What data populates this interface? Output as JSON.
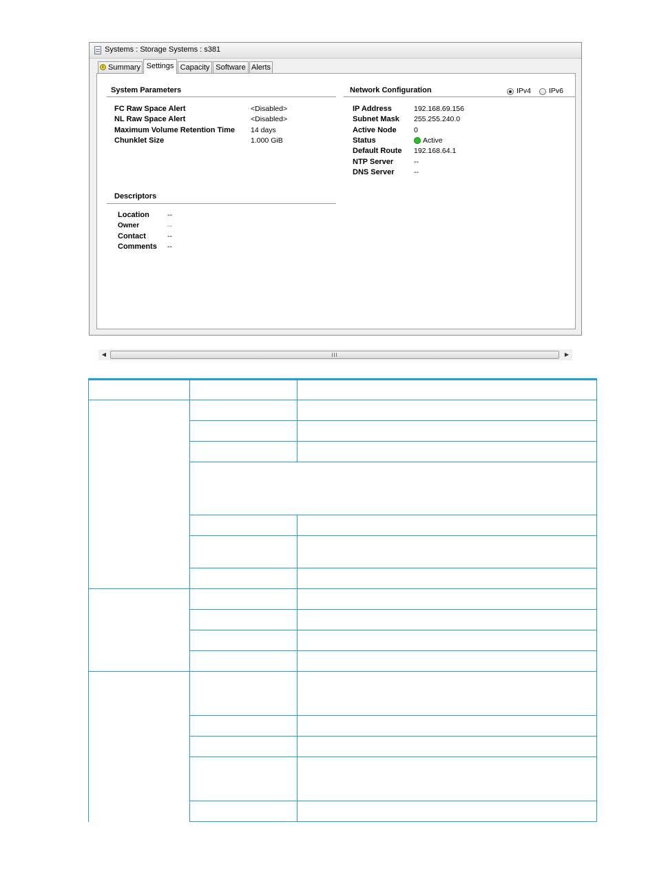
{
  "window": {
    "title": "Systems : Storage Systems : s381",
    "icon": "storage-system-icon"
  },
  "tabs": [
    {
      "label": "Summary",
      "icon": "summary-status-icon"
    },
    {
      "label": "Settings",
      "active": true
    },
    {
      "label": "Capacity"
    },
    {
      "label": "Software"
    },
    {
      "label": "Alerts"
    }
  ],
  "system_parameters": {
    "title": "System Parameters",
    "rows": [
      {
        "label": "FC Raw Space Alert",
        "value": "<Disabled>"
      },
      {
        "label": "NL Raw Space Alert",
        "value": "<Disabled>"
      },
      {
        "label": "Maximum Volume Retention Time",
        "value": "14 days"
      },
      {
        "label": "Chunklet Size",
        "value": "1.000 GiB"
      }
    ]
  },
  "descriptors": {
    "title": "Descriptors",
    "rows": [
      {
        "label": "Location",
        "value": "--"
      },
      {
        "label": "Owner",
        "value": "--"
      },
      {
        "label": "Contact",
        "value": "--"
      },
      {
        "label": "Comments",
        "value": "--"
      }
    ]
  },
  "network_configuration": {
    "title": "Network Configuration",
    "ip_versions": [
      {
        "label": "IPv4",
        "selected": true
      },
      {
        "label": "IPv6",
        "selected": false
      }
    ],
    "rows": [
      {
        "label": "IP Address",
        "value": "192.168.69.156"
      },
      {
        "label": "Subnet Mask",
        "value": "255.255.240.0"
      },
      {
        "label": "Active Node",
        "value": "0"
      },
      {
        "label": "Status",
        "value": "Active",
        "status_color": "#22c322"
      },
      {
        "label": "Default Route",
        "value": "192.168.64.1"
      },
      {
        "label": "NTP Server",
        "value": "--"
      },
      {
        "label": "DNS Server",
        "value": "--"
      }
    ]
  },
  "colors": {
    "table_rule": "#1e9fdb"
  }
}
